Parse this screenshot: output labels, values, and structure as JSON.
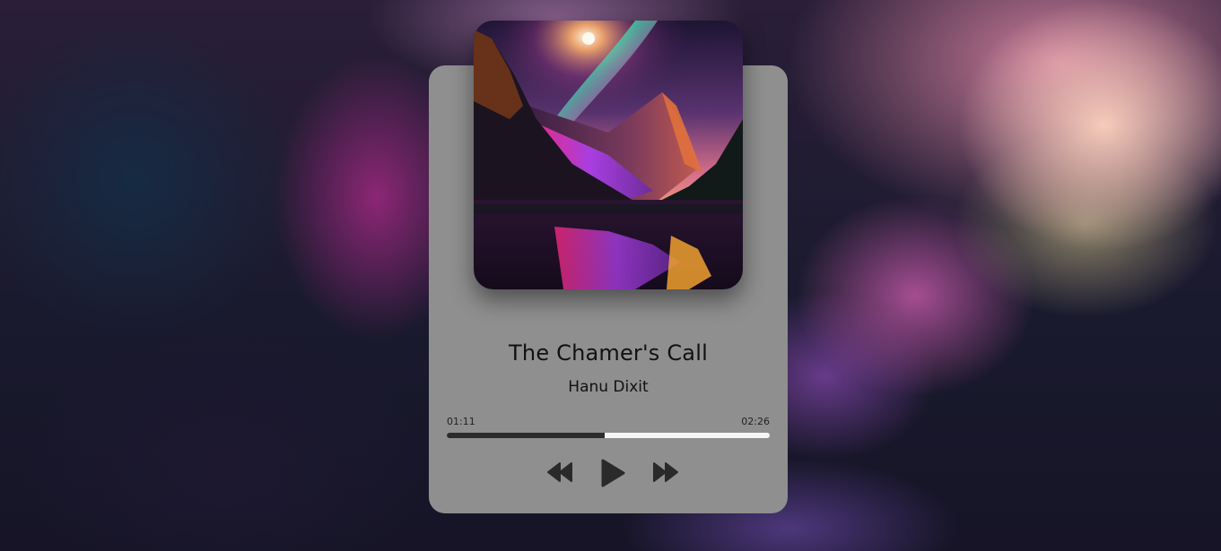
{
  "player": {
    "title": "The Chamer's Call",
    "artist": "Hanu Dixit",
    "current_time": "01:11",
    "total_time": "02:26",
    "progress_fraction": 0.49
  },
  "icons": {
    "rewind": "rewind-icon",
    "play": "play-icon",
    "forward": "fast-forward-icon"
  },
  "colors": {
    "card": "#8f8f8f",
    "progress_fill": "#2c2c2c",
    "progress_track": "#f5f5f5",
    "icon": "#2a2a2a"
  }
}
